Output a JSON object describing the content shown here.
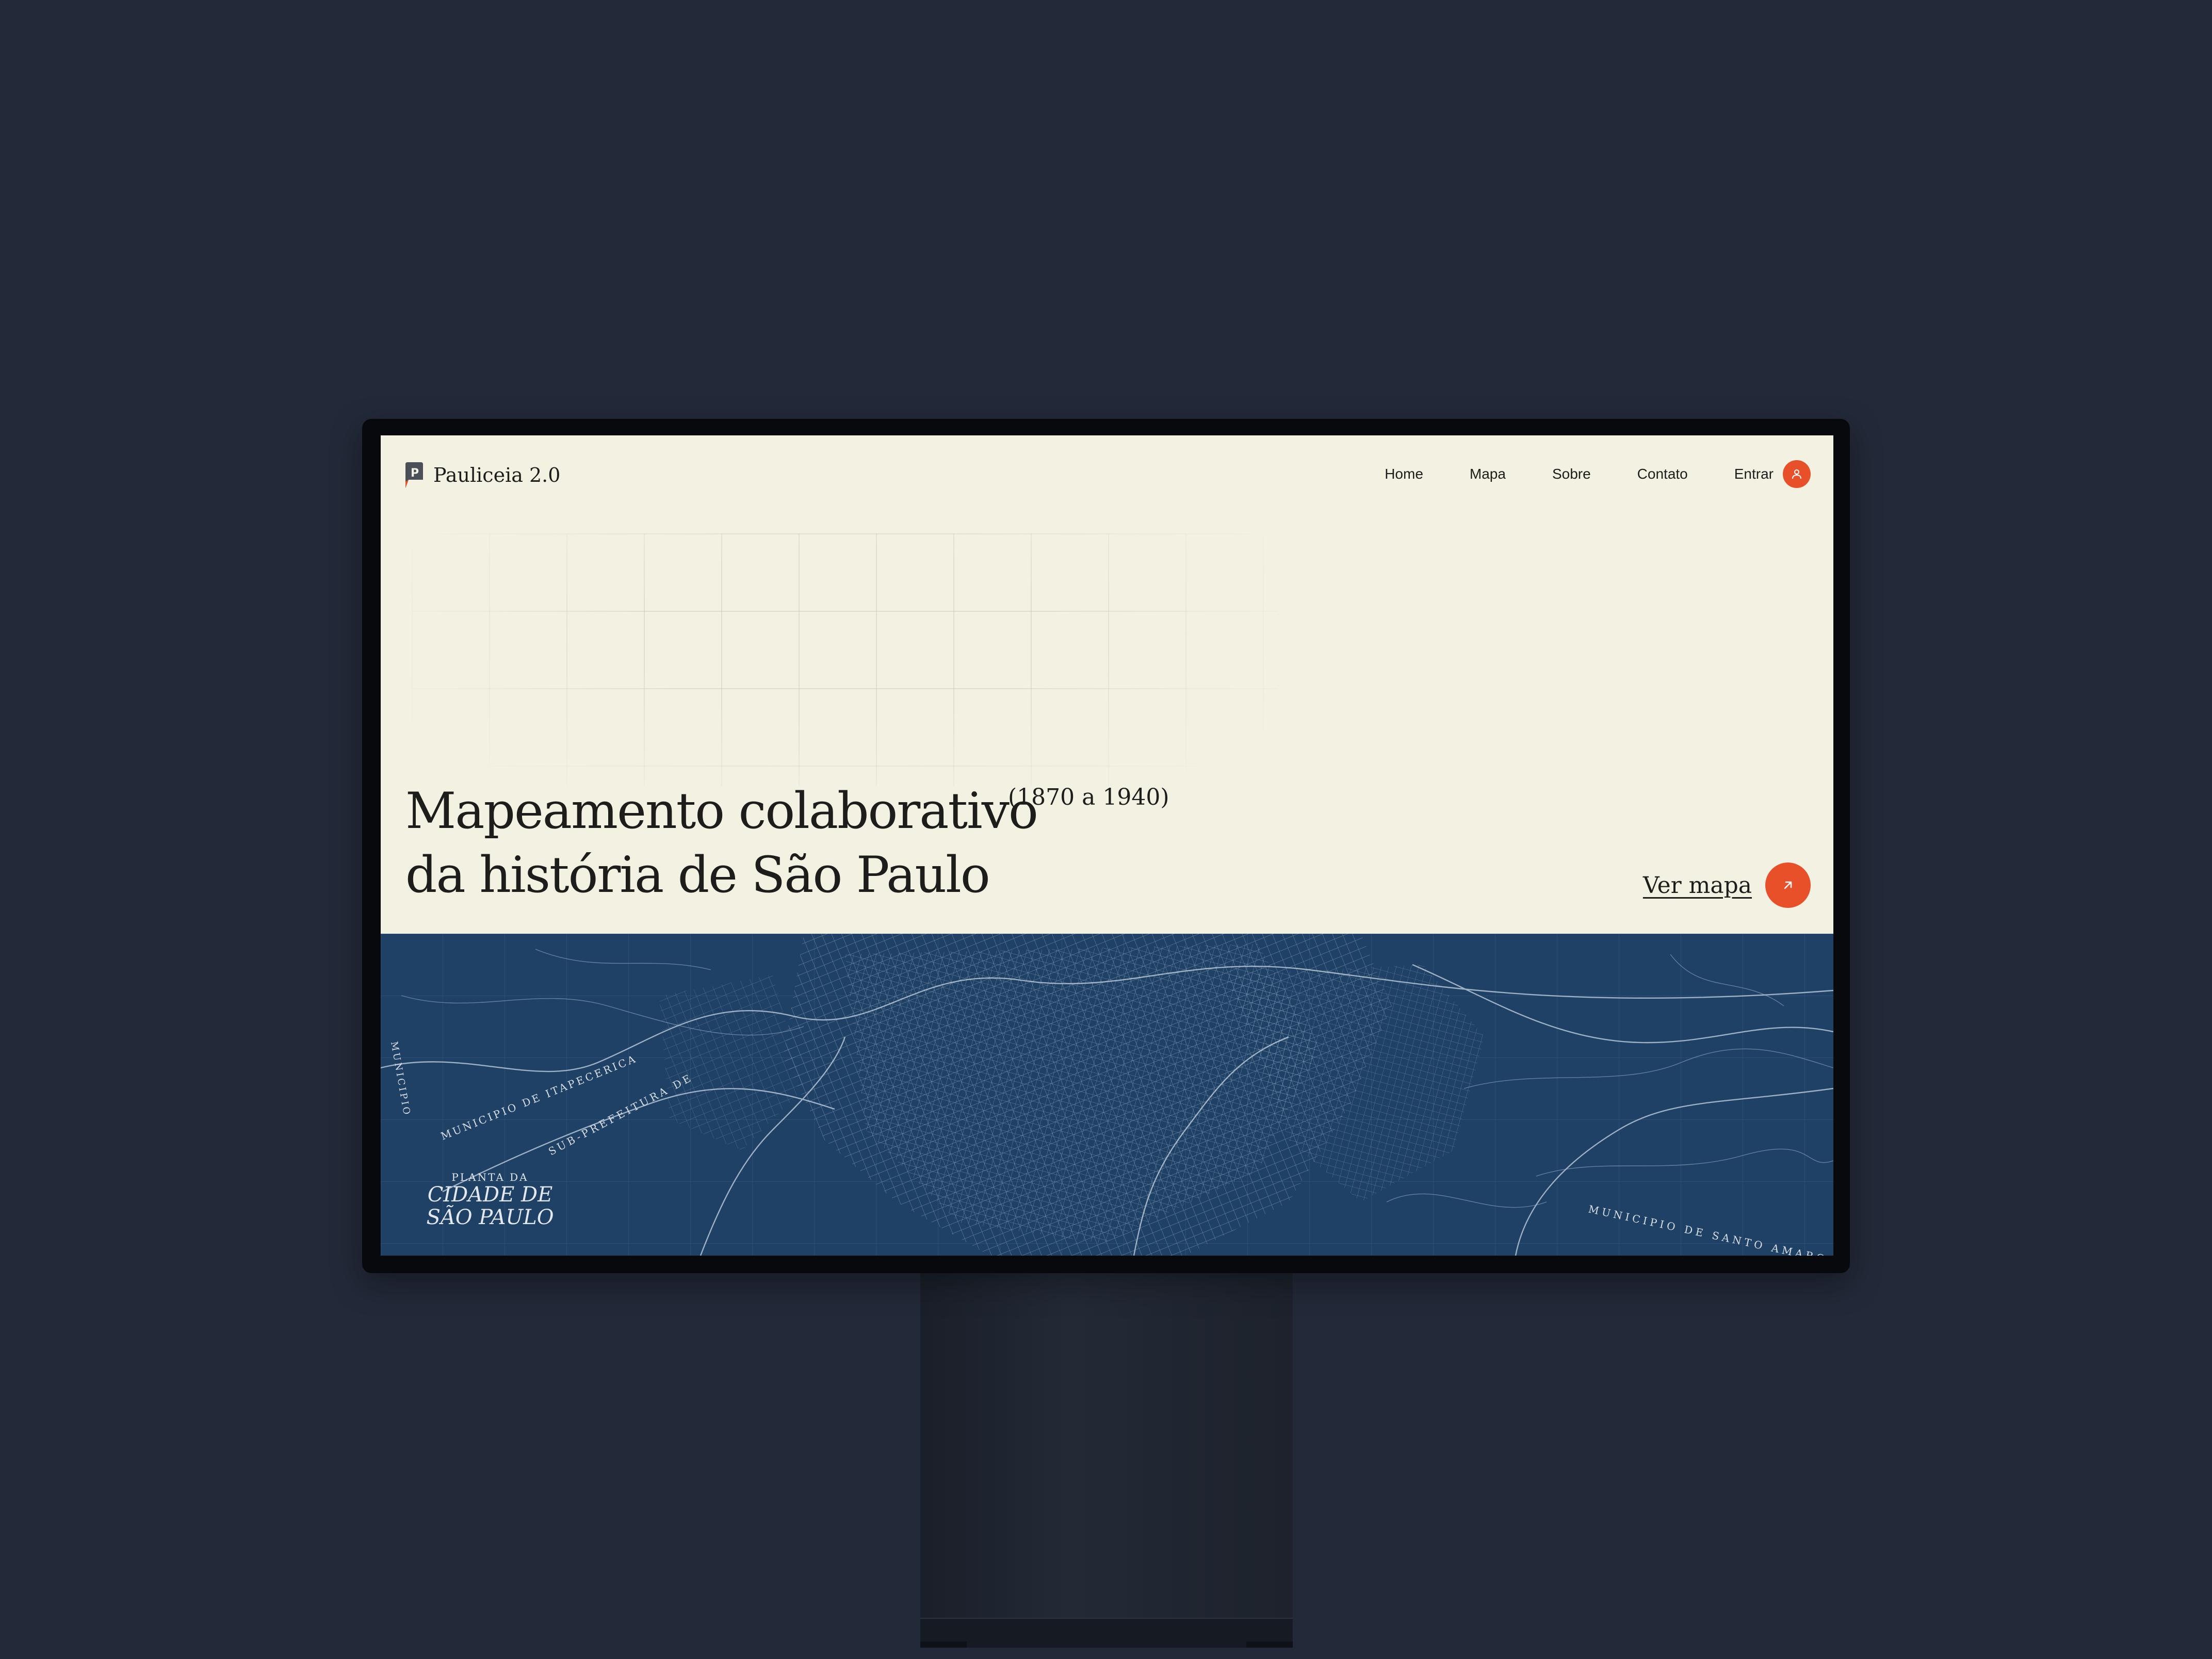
{
  "app": {
    "brand_name": "Pauliceia 2.0"
  },
  "nav": {
    "links": [
      "Home",
      "Mapa",
      "Sobre",
      "Contato"
    ],
    "login_label": "Entrar"
  },
  "hero": {
    "title_line1": "Mapeamento colaborativo",
    "title_line2": "da história de São Paulo",
    "years": "(1870 a 1940)",
    "cta_label": "Ver mapa"
  },
  "map": {
    "cartouche_line1": "PLANTA DA",
    "cartouche_line2": "CIDADE DE SÃO PAULO",
    "labels": {
      "itapecerica": "MUNICIPIO DE ITAPECERICA",
      "sub_prefeitura": "SUB-PREFEITURA DE",
      "santo_amaro": "MUNICIPIO DE SANTO AMARO",
      "left_edge": "MUNICIPIO"
    }
  },
  "colors": {
    "page_background": "#222938",
    "screen_background": "#f3f2e2",
    "accent": "#e8502a",
    "map_blue": "#1f4166",
    "text": "#1d1d1b"
  },
  "icons": {
    "logo": "pauliceia-p-logo",
    "user": "user-icon",
    "cta": "arrow-up-right-icon"
  }
}
